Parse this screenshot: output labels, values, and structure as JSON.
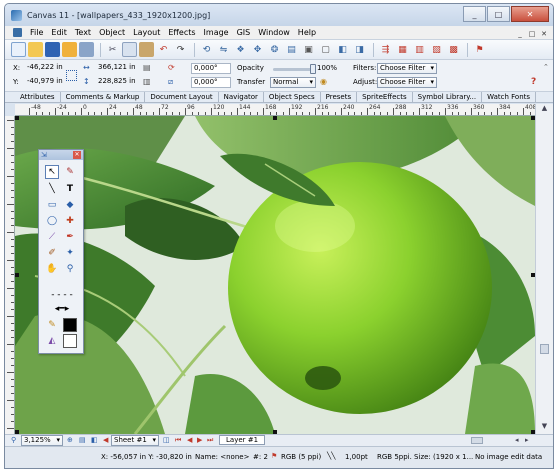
{
  "window": {
    "title": "Canvas 11 - [wallpapers_433_1920x1200.jpg]",
    "controls": [
      "_",
      "□",
      "✕"
    ]
  },
  "menu": {
    "items": [
      "File",
      "Edit",
      "Text",
      "Object",
      "Layout",
      "Effects",
      "Image",
      "GIS",
      "Window",
      "Help"
    ],
    "mdi_controls": [
      "_",
      "□",
      "✕"
    ]
  },
  "toolbar": {
    "icons": [
      "new-icon",
      "open-icon",
      "save-icon",
      "print-setup-icon",
      "print-icon",
      "cut-icon",
      "copy-icon",
      "paste-icon",
      "undo-icon",
      "redo-icon",
      "rotate-icon",
      "flip-icon",
      "group-icon",
      "ungroup-icon",
      "combine-icon",
      "align-icon",
      "lock-icon",
      "unlock-icon",
      "bring-front-icon",
      "send-back-icon",
      "layout-icon",
      "chart-icon",
      "chart2-icon",
      "chart3-icon",
      "present-icon",
      "help-tool-icon"
    ]
  },
  "properties": {
    "x_label": "X:",
    "x_value": "-46,222 in",
    "y_label": "Y:",
    "y_value": "-40,979 in",
    "w_value": "366,121 in",
    "h_value": "228,825 in",
    "angle1": "0,000°",
    "angle2": "0,000°",
    "opacity_label": "Opacity",
    "opacity_value": "100%",
    "opacity_level": 1.0,
    "transfer_label": "Transfer",
    "transfer_value": "Normal",
    "filters_label": "Filters:",
    "filters_value": "Choose Filter",
    "adjust_label": "Adjust:",
    "adjust_value": "Choose Filter"
  },
  "panel_tabs": [
    "Attributes",
    "Comments & Markup",
    "Document Layout",
    "Navigator",
    "Object Specs",
    "Presets",
    "SpriteEffects",
    "Symbol Library...",
    "Watch Fonts"
  ],
  "ruler": {
    "labels": [
      "-48",
      "-24",
      "0",
      "24",
      "48",
      "72",
      "96",
      "120",
      "144",
      "168",
      "192",
      "216",
      "240",
      "264",
      "288",
      "312",
      "336",
      "360",
      "384",
      "408"
    ]
  },
  "palette": {
    "tools": [
      "select-arrow-icon",
      "pen-icon",
      "line-icon",
      "text-tool-icon",
      "rectangle-icon",
      "eraser-icon",
      "ellipse-icon",
      "pipette-icon",
      "brush-icon",
      "fill-icon",
      "clone-icon",
      "magic-wand-icon",
      "hand-icon",
      "zoom-icon",
      "dashed-line-icon",
      "arrow-line-icon",
      "stroke-color-icon",
      "fill-color-icon"
    ]
  },
  "bottom": {
    "zoom": "3,125%",
    "sheet": "Sheet #1",
    "layer": "Layer #1"
  },
  "status": {
    "coords": "X: -56,057 in Y: -30,820 in",
    "name": "Name: <none>",
    "count": "#: 2",
    "color_mode": "RGB (5 ppi)",
    "stroke": "1,00pt",
    "image_info": "RGB 5ppi. Size: (1920 x 1...",
    "edit_data": "No image edit data"
  },
  "colors": {
    "window_frame": "#d9e3ef",
    "title_gradient_top": "#dbe6f4",
    "apple": "#8bd12e",
    "leaf": "#4d8a2c",
    "stroke_swatch": "#000000",
    "fill_swatch": "#ffffff"
  }
}
